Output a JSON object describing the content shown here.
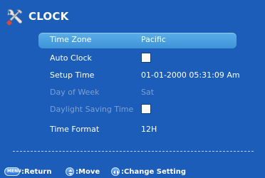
{
  "header": {
    "title": "CLOCK",
    "icon": "tools-icon"
  },
  "menu": {
    "items": [
      {
        "label": "Time Zone",
        "value": "Pacific",
        "selected": true,
        "disabled": false,
        "type": "value"
      },
      {
        "label": "Auto Clock",
        "checked": true,
        "selected": false,
        "disabled": false,
        "type": "checkbox"
      },
      {
        "label": "Setup Time",
        "value": "01-01-2000 05:31:09 Am",
        "selected": false,
        "disabled": false,
        "type": "value"
      },
      {
        "label": "Day of Week",
        "value": "Sat",
        "selected": false,
        "disabled": true,
        "type": "value"
      },
      {
        "label": "Daylight Saving Time",
        "checked": true,
        "selected": false,
        "disabled": true,
        "type": "checkbox"
      },
      {
        "label": "Time Format",
        "value": "12H",
        "selected": false,
        "disabled": false,
        "type": "value"
      }
    ]
  },
  "hints": {
    "menu_key_label": "MENU",
    "return": ":Return",
    "move": ":Move",
    "change": ":Change Setting"
  },
  "colors": {
    "background": "#1b5db8",
    "selected_row": "#4aa2e2",
    "disabled_text": "#7f9fd0"
  }
}
